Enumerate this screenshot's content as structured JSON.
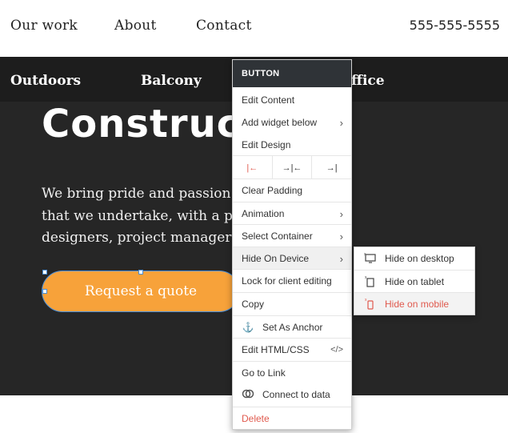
{
  "topnav": {
    "links": [
      "Our work",
      "About",
      "Contact"
    ],
    "phone": "555-555-5555"
  },
  "subnav": {
    "items": [
      "Outdoors",
      "Balcony",
      "ffice"
    ]
  },
  "hero": {
    "title": "Construct",
    "paragraph_lines": [
      "We bring pride and passion t",
      "that we undertake, with a pr",
      "designers, project managers"
    ],
    "cta_label": "Request a quote"
  },
  "context_menu": {
    "header": "BUTTON",
    "items": {
      "edit_content": "Edit Content",
      "add_widget_below": "Add widget below",
      "edit_design": "Edit Design",
      "clear_padding": "Clear Padding",
      "animation": "Animation",
      "select_container": "Select Container",
      "hide_on_device": "Hide On Device",
      "lock_for_client_editing": "Lock for client editing",
      "copy": "Copy",
      "set_as_anchor": "Set As Anchor",
      "edit_html_css": "Edit HTML/CSS",
      "go_to_link": "Go to Link",
      "connect_to_data": "Connect to data",
      "delete": "Delete"
    },
    "align_icons": [
      "align-left-icon",
      "align-center-icon",
      "align-right-icon"
    ]
  },
  "submenu": {
    "items": [
      "Hide on desktop",
      "Hide on tablet",
      "Hide on mobile"
    ],
    "active_index": 2
  },
  "colors": {
    "hero_bg": "#262626",
    "subnav_bg": "#1d1d1d",
    "cta_bg": "#f7a23a",
    "menu_header_bg": "#2f3337",
    "accent_red": "#e05a4e",
    "selection_blue": "#4a8fd9"
  }
}
